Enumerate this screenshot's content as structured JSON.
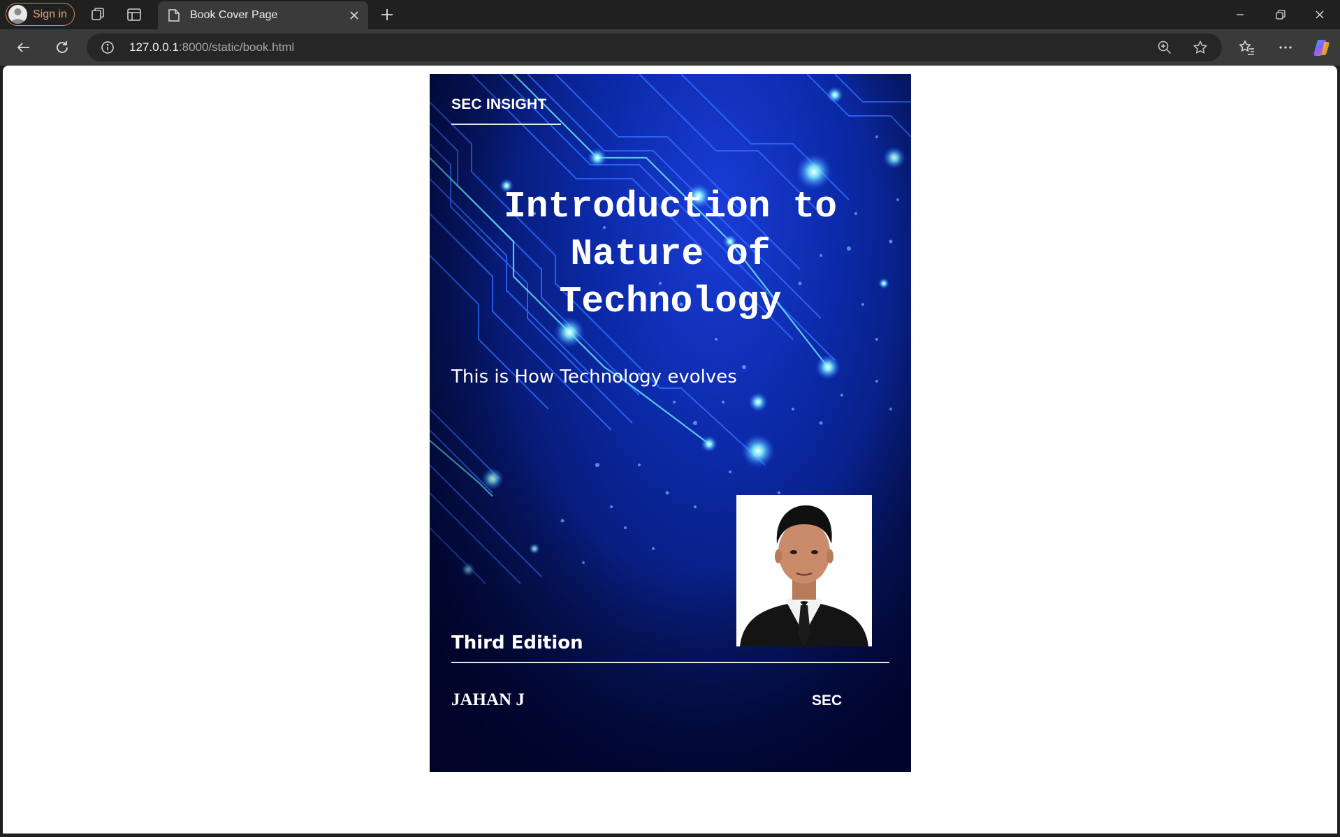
{
  "browser": {
    "signin_label": "Sign in",
    "tab_title": "Book Cover Page",
    "url_host": "127.0.0.1",
    "url_rest": ":8000/static/book.html"
  },
  "cover": {
    "brand": "SEC INSIGHT",
    "title_lines": [
      "Introduction to",
      "Nature of",
      "Technology"
    ],
    "subtitle": "This is How Technology evolves",
    "edition": "Third Edition",
    "author": "JAHAN J",
    "publisher": "SEC"
  },
  "colors": {
    "cover_background": "#0b2aa8",
    "circuit_line": "#2f6bff",
    "circuit_glow": "#6ff0ff",
    "signin_accent": "#e0844f"
  }
}
